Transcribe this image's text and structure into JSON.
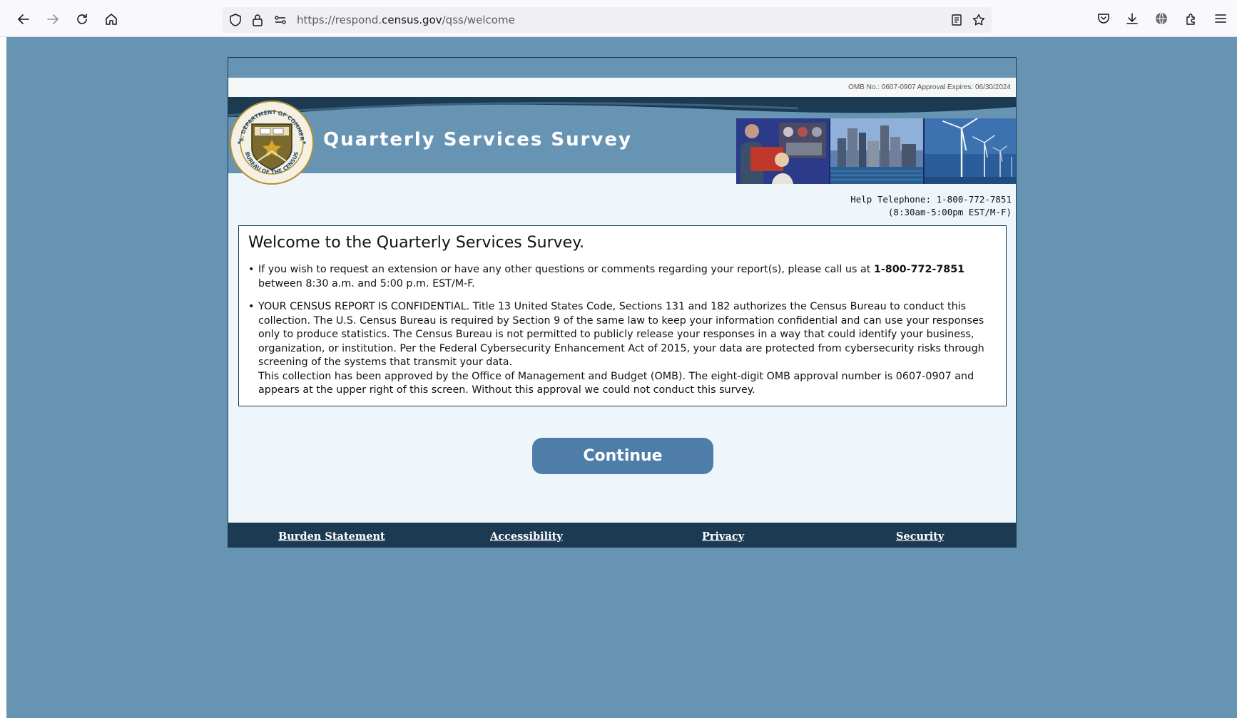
{
  "browser": {
    "url_prefix": "https://respond.",
    "url_domain": "census.gov",
    "url_path": "/qss/welcome",
    "icons": [
      "back-icon",
      "forward-icon",
      "reload-icon",
      "home-icon",
      "shield-icon",
      "lock-icon",
      "permissions-icon",
      "reader-view-icon",
      "star-icon",
      "pocket-icon",
      "download-icon",
      "extensions-globe-icon",
      "puzzle-icon",
      "menu-icon"
    ]
  },
  "header": {
    "omb": "OMB No.: 0607-0907 Approval Expires: 06/30/2024",
    "title": "Quarterly Services Survey",
    "seal_alt": "U.S. Department of Commerce Bureau of the Census seal",
    "seal_text": "U.S. DEPARTMENT OF COMMERCE · BUREAU OF THE CENSUS"
  },
  "help": {
    "line1": "Help Telephone: 1-800-772-7851",
    "line2": "(8:30am-5:00pm EST/M-F)"
  },
  "welcome": {
    "title": "Welcome to the Quarterly Services Survey.",
    "bullet1_a": "If you wish to request an extension or have any other questions or comments regarding your report(s), please call us at ",
    "bullet1_phone": "1-800-772-7851",
    "bullet1_b": "between 8:30 a.m. and 5:00 p.m. EST/M-F.",
    "bullet2_a": "YOUR CENSUS REPORT IS CONFIDENTIAL. Title 13 United States Code, Sections 131 and 182 authorizes the Census Bureau to conduct this collection. The U.S. Census Bureau is required by Section 9 of the same law to keep your information confidential and can use your responses only to produce statistics. The Census Bureau is not permitted to publicly release your responses in a way that could identify your business, organization, or institution. Per the Federal Cybersecurity Enhancement Act of 2015, your data are protected from cybersecurity risks through screening of the systems that transmit your data.",
    "bullet2_b": "This collection has been approved by the Office of Management and Budget (OMB). The eight-digit OMB approval number is 0607-0907 and appears at the upper right of this screen. Without this approval we could not conduct this survey."
  },
  "continue_label": "Continue",
  "footer": {
    "burden": "Burden Statement",
    "accessibility": "Accessibility",
    "privacy": "Privacy",
    "security": "Security"
  },
  "colors": {
    "page_bg": "#6894b4",
    "navy": "#1d3a53",
    "button": "#4d7da8",
    "content_bg": "#eef6fc"
  }
}
